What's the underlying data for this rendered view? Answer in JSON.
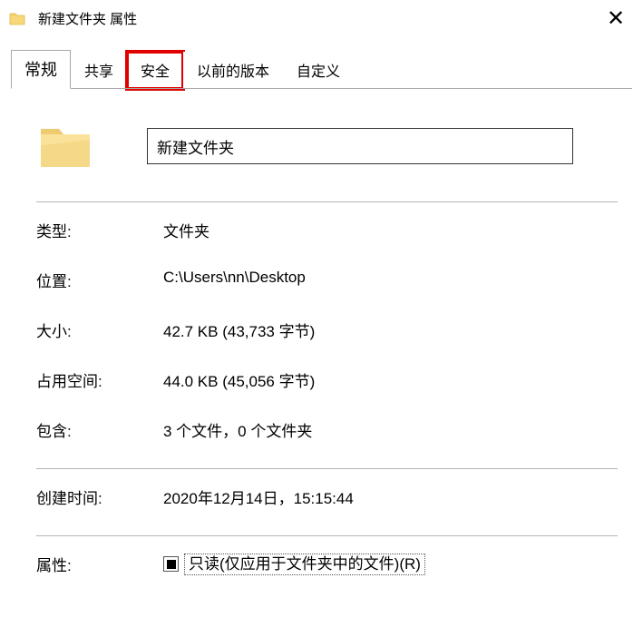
{
  "window": {
    "title": "新建文件夹 属性"
  },
  "tabs": {
    "general": "常规",
    "sharing": "共享",
    "security": "安全",
    "previous": "以前的版本",
    "customize": "自定义"
  },
  "name_input": "新建文件夹",
  "fields": {
    "type_label": "类型:",
    "type_value": "文件夹",
    "location_label": "位置:",
    "location_value": "C:\\Users\\nn\\Desktop",
    "size_label": "大小:",
    "size_value": "42.7 KB (43,733 字节)",
    "size_on_disk_label": "占用空间:",
    "size_on_disk_value": "44.0 KB (45,056 字节)",
    "contains_label": "包含:",
    "contains_value": "3 个文件，0 个文件夹",
    "created_label": "创建时间:",
    "created_value": "2020年12月14日，15:15:44",
    "attributes_label": "属性:",
    "readonly_text": "只读(仅应用于文件夹中的文件)(R)"
  }
}
